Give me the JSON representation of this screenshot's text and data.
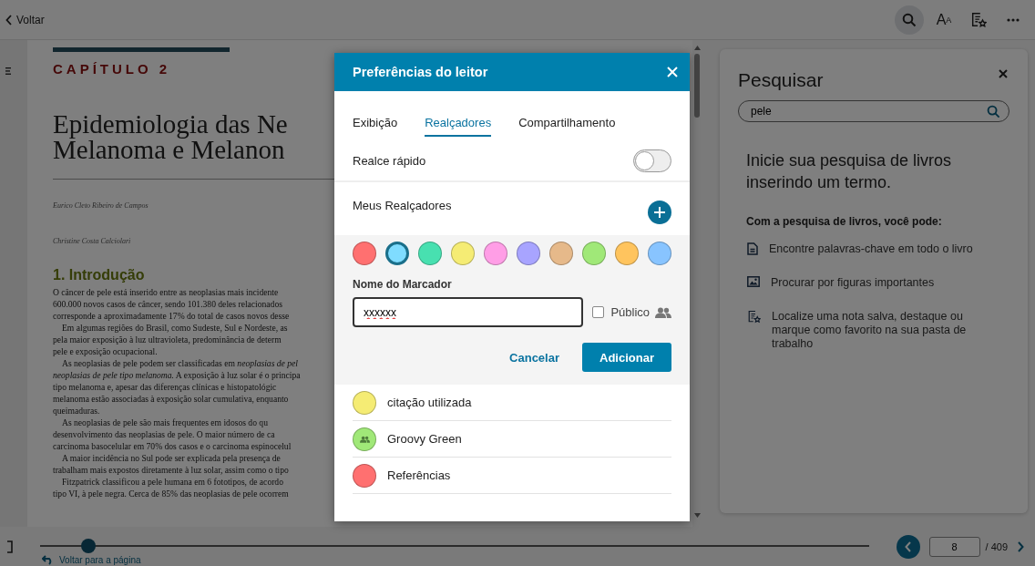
{
  "topbar": {
    "back": "Voltar",
    "toolbar": [
      {
        "kind": "search",
        "selected": true
      },
      {
        "kind": "font",
        "label": "A",
        "sub": "A",
        "selected": false
      },
      {
        "kind": "notes",
        "selected": false
      },
      {
        "kind": "more",
        "selected": false
      }
    ]
  },
  "book": {
    "chapter": "CAPÍTULO 2",
    "title_lines": [
      "Epidemiologia das Ne",
      "Melanoma e Melanon"
    ],
    "authors": [
      "Eurico Cleto Ribeiro de Campos",
      "Christine Costa Calciolari"
    ],
    "section": "1. Introdução",
    "lines": [
      {
        "text": "O câncer de pele está inserido entre as neoplasias mais incidente",
        "indent": false
      },
      {
        "text": "600.000 novos casos de câncer, sendo 101.380 deles relacionados",
        "indent": false
      },
      {
        "text": "corresponde a aproximadamente 17% do total de casos novos desse",
        "indent": false
      },
      {
        "text": "Em algumas regiões do Brasil, como Sudeste, Sul e Nordeste, as",
        "indent": true
      },
      {
        "text": "pela maior exposição à luz ultravioleta, predominância de determ",
        "indent": false
      },
      {
        "text": "pele e exposição ocupacional.",
        "indent": false
      },
      {
        "text": "As neoplasias de pele podem ser classificadas em *neoplasias de pel*",
        "indent": true
      },
      {
        "text": "*neoplasias de pele tipo melanoma.* A exposição à luz solar é o principa",
        "indent": false
      },
      {
        "text": "tipo melanoma e, apesar das diferenças clínicas e histopatológic",
        "indent": false
      },
      {
        "text": "melanoma estão associadas à exposição solar cumulativa, enquanto",
        "indent": false
      },
      {
        "text": "queimaduras.",
        "indent": false
      },
      {
        "text": "As neoplasias de pele são mais frequentes em idosos do qu",
        "indent": true
      },
      {
        "text": "desenvolvimento das neoplasias de pele. O maior número de ca",
        "indent": false
      },
      {
        "text": "carcinoma basocelular em 70% dos casos e o carcinoma espinocelul",
        "indent": false
      },
      {
        "text": "A maior incidência no Sul pode ser explicada pela presença de",
        "indent": true
      },
      {
        "text": "trabalham mais expostos diretamente à luz solar, assim como o tipo",
        "indent": false
      },
      {
        "text": "Fitzpatrick classificou a pele humana em 6 fototipos, de acordo",
        "indent": true
      },
      {
        "text": "tipo VI, à pele negra. Cerca de 85% das neoplasias de pele ocorrem",
        "indent": false
      }
    ]
  },
  "search_panel": {
    "title": "Pesquisar",
    "query": "pele",
    "intro": "Inicie sua pesquisa de livros inserindo um termo.",
    "subtitle": "Com a pesquisa de livros, você pode:",
    "features": [
      {
        "kind": "document",
        "text": "Encontre palavras-chave em todo o livro"
      },
      {
        "kind": "image",
        "text": "Procurar por figuras importantes"
      },
      {
        "kind": "notes",
        "text": "Localize uma nota salva, destaque ou marque como favorito na sua pasta de trabalho"
      }
    ]
  },
  "dialog": {
    "title": "Preferências do leitor",
    "tabs": [
      {
        "label": "Exibição",
        "selected": false
      },
      {
        "label": "Realçadores",
        "selected": true
      },
      {
        "label": "Compartilhamento",
        "selected": false
      }
    ],
    "quick_highlight": {
      "label": "Realce rápido",
      "on": false
    },
    "my_highlighters": "Meus Realçadores",
    "colors": [
      {
        "color": "#ff7070",
        "selected": false
      },
      {
        "color": "#7fdcff",
        "selected": true
      },
      {
        "color": "#48e0b0",
        "selected": false
      },
      {
        "color": "#f5ec74",
        "selected": false
      },
      {
        "color": "#ff9ee6",
        "selected": false
      },
      {
        "color": "#a8a4ff",
        "selected": false
      },
      {
        "color": "#e6b98a",
        "selected": false
      },
      {
        "color": "#a0e878",
        "selected": false
      },
      {
        "color": "#ffc45e",
        "selected": false
      },
      {
        "color": "#88c4ff",
        "selected": false
      }
    ],
    "name_label": "Nome do Marcador",
    "name_value": "xxxxxx",
    "public": {
      "label": "Público",
      "checked": false
    },
    "cancel": "Cancelar",
    "add": "Adicionar",
    "highlighters": [
      {
        "name": "citação utilizada",
        "color": "#f5ec74",
        "public": false
      },
      {
        "name": "Groovy Green",
        "color": "#a0e878",
        "public": true
      },
      {
        "name": "Referências",
        "color": "#ff7070",
        "public": false
      }
    ]
  },
  "footer": {
    "progress": {
      "level": 0.058
    },
    "back_link": "Voltar para a página",
    "page": "8",
    "total": "/ 409"
  }
}
